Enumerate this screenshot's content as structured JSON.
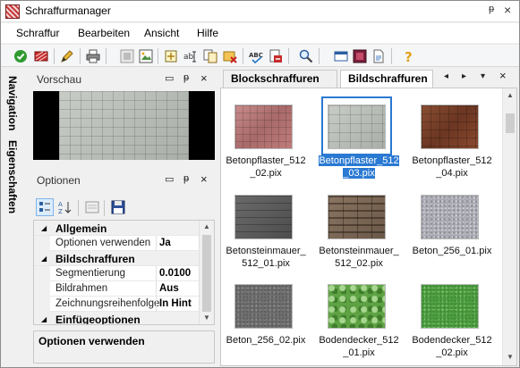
{
  "window": {
    "title": "Schraffurmanager",
    "pin_glyph": "ᵽ",
    "close_glyph": "×"
  },
  "menu": {
    "items": [
      "Schraffur",
      "Bearbeiten",
      "Ansicht",
      "Hilfe"
    ]
  },
  "toolbar": {
    "icons": [
      "ok-icon",
      "delete-icon",
      "edit-icon",
      "print-icon",
      "preview-icon",
      "image-icon",
      "new-icon",
      "rename-icon",
      "copy-icon",
      "move-icon",
      "spellcheck-icon",
      "export-icon",
      "search-icon",
      "window-icon",
      "stop-icon",
      "document-icon",
      "help-icon"
    ]
  },
  "side_tabs": {
    "navigation": "Navigation",
    "properties": "Eigenschaften"
  },
  "preview_pane": {
    "title": "Vorschau"
  },
  "options_pane": {
    "title": "Optionen",
    "rows": [
      {
        "type": "category",
        "label": "Allgemein"
      },
      {
        "type": "property",
        "label": "Optionen verwenden",
        "value": "Ja"
      },
      {
        "type": "category",
        "label": "Bildschraffuren"
      },
      {
        "type": "property",
        "label": "Segmentierung",
        "value": "0.0100"
      },
      {
        "type": "property",
        "label": "Bildrahmen",
        "value": "Aus"
      },
      {
        "type": "property",
        "label": "Zeichnungsreihenfolge",
        "value": "In Hint"
      },
      {
        "type": "category",
        "label": "Einfügeoptionen"
      }
    ],
    "description_title": "Optionen verwenden"
  },
  "tabs": {
    "items": [
      "Blockschraffuren",
      "Bildschraffuren"
    ],
    "active_index": 1
  },
  "tiles": [
    {
      "label_line1": "Betonpflaster_512",
      "label_line2": "_02.pix",
      "texture": "t-red",
      "selected": false
    },
    {
      "label_line1": "Betonpflaster_512",
      "label_line2": "_03.pix",
      "texture": "t-grey1",
      "selected": true
    },
    {
      "label_line1": "Betonpflaster_512",
      "label_line2": "_04.pix",
      "texture": "t-brown",
      "selected": false
    },
    {
      "label_line1": "Betonsteinmauer_",
      "label_line2": "512_01.pix",
      "texture": "t-dark",
      "selected": false
    },
    {
      "label_line1": "Betonsteinmauer_",
      "label_line2": "512_02.pix",
      "texture": "t-brick",
      "selected": false
    },
    {
      "label_line1": "Beton_256_01.pix",
      "label_line2": "",
      "texture": "t-granite",
      "selected": false
    },
    {
      "label_line1": "Beton_256_02.pix",
      "label_line2": "",
      "texture": "t-asphalt",
      "selected": false
    },
    {
      "label_line1": "Bodendecker_512",
      "label_line2": "_01.pix",
      "texture": "t-leaves",
      "selected": false
    },
    {
      "label_line1": "Bodendecker_512",
      "label_line2": "_02.pix",
      "texture": "t-grass",
      "selected": false
    }
  ],
  "colors": {
    "selection": "#2a79d2",
    "title_bg": "#ffffff",
    "panel_bg": "#f0f0f0"
  }
}
